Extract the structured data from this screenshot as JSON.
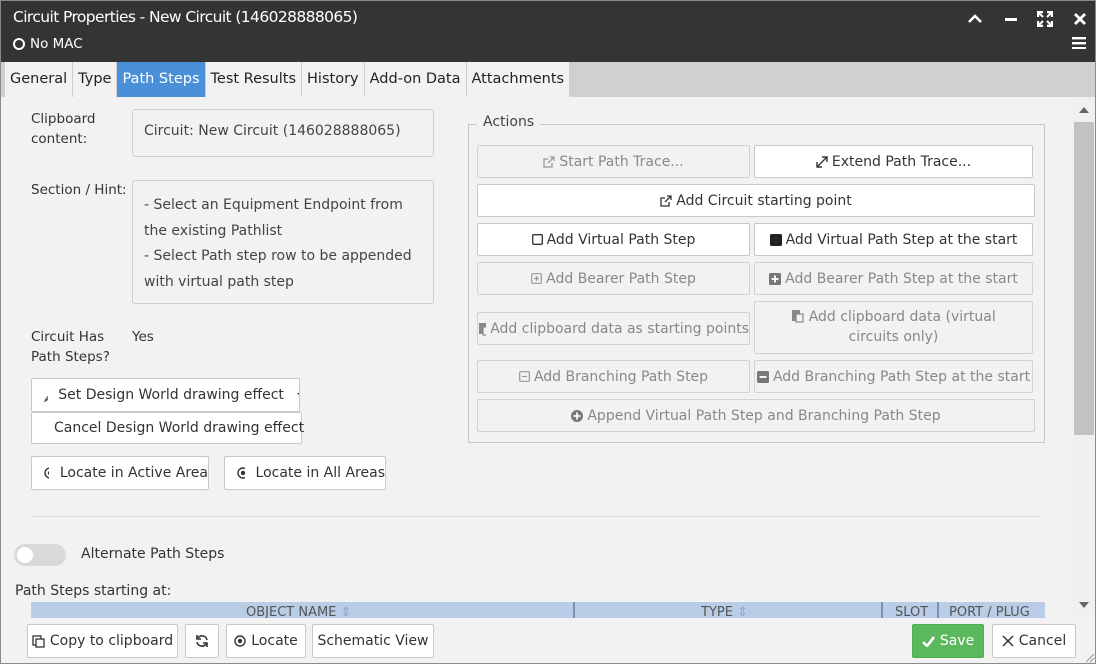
{
  "window": {
    "title": "Circuit Properties - New Circuit (146028888065)",
    "subtitle": "No MAC"
  },
  "tabs": [
    "General",
    "Type",
    "Path Steps",
    "Test Results",
    "History",
    "Add-on Data",
    "Attachments"
  ],
  "active_tab": "Path Steps",
  "left": {
    "clipboard_label": "Clipboard\ncontent:",
    "clipboard_value": "Circuit: New Circuit (146028888065)",
    "section_label": "Section / Hint:",
    "hint_line1": "- Select an Equipment Endpoint from the existing Pathlist",
    "hint_line2": "- Select Path step row to be appended with virtual path step",
    "has_steps_label": "Circuit Has\nPath Steps?",
    "has_steps_value": "Yes",
    "set_effect": "Set Design World drawing effect",
    "cancel_effect": "Cancel Design World drawing effect",
    "locate_active": "Locate in Active Area",
    "locate_all": "Locate in All Areas"
  },
  "actions": {
    "legend": "Actions",
    "start_trace": "Start Path Trace...",
    "extend_trace": "Extend Path Trace...",
    "add_start_point": "Add Circuit starting point",
    "add_virtual": "Add Virtual Path Step",
    "add_virtual_start": "Add Virtual Path Step at the start",
    "add_bearer": "Add Bearer Path Step",
    "add_bearer_start": "Add Bearer Path Step at the start",
    "add_clip_start": "Add clipboard data as starting points",
    "add_clip_virtual": "Add clipboard data (virtual circuits only)",
    "add_branch": "Add Branching Path Step",
    "add_branch_start": "Add Branching Path Step at the start",
    "append_both": "Append Virtual Path Step and Branching Path Step"
  },
  "alt": {
    "toggle_label": "Alternate Path Steps",
    "starting_label": "Path Steps starting at:"
  },
  "table": {
    "columns": [
      "OBJECT NAME",
      "TYPE",
      "SLOT",
      "PORT / PLUG"
    ]
  },
  "footer": {
    "copy": "Copy to clipboard",
    "locate": "Locate",
    "schematic": "Schematic View",
    "save": "Save",
    "cancel": "Cancel"
  },
  "colors": {
    "titlebar": "#343434",
    "active_tab": "#4a90d9",
    "save": "#5cb85c",
    "table_header": "#b9cde6"
  }
}
